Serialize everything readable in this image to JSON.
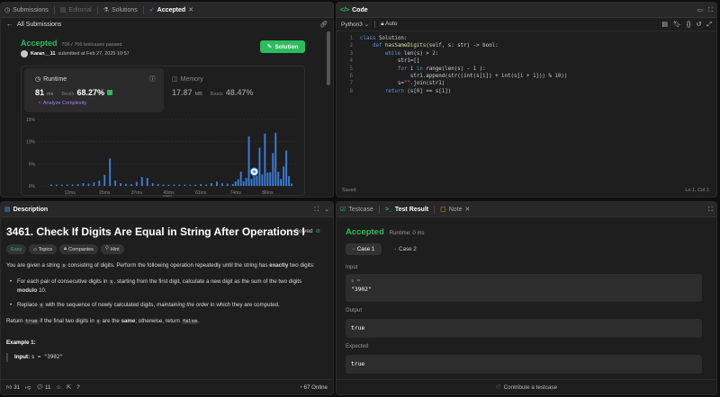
{
  "submissions_panel": {
    "tabs": [
      {
        "label": "Submissions",
        "icon": "clock-icon"
      },
      {
        "label": "Editorial",
        "icon": "book-icon"
      },
      {
        "label": "Solutions",
        "icon": "flask-icon"
      },
      {
        "label": "Accepted",
        "icon": "check-icon"
      }
    ],
    "back_label": "All Submissions",
    "status": "Accepted",
    "passed": "706 / 706 testcases passed",
    "user": "Karan__11",
    "submitted": "submitted at Feb 27, 2025 10:57",
    "solution_button": "Solution",
    "runtime": {
      "label": "Runtime",
      "value": "81",
      "unit": "ms",
      "beats_label": "Beats",
      "beats": "68.27%",
      "analyze": "Analyze Complexity"
    },
    "memory": {
      "label": "Memory",
      "value": "17.87",
      "unit": "MB",
      "beats_label": "Beats",
      "beats": "48.47%"
    }
  },
  "chart_data": {
    "type": "bar",
    "yticks": [
      "15%",
      "10%",
      "5%",
      "0%"
    ],
    "ylim": [
      0,
      15
    ],
    "xticks": [
      "12ms",
      "25ms",
      "37ms",
      "49ms",
      "61ms",
      "74ms",
      "86ms"
    ],
    "x": [
      5,
      7,
      9,
      11,
      13,
      15,
      17,
      19,
      21,
      23,
      25,
      27,
      29,
      31,
      33,
      35,
      37,
      39,
      41,
      43,
      45,
      47,
      49,
      51,
      53,
      55,
      57,
      59,
      61,
      63,
      65,
      67,
      69,
      71,
      73,
      74,
      75,
      76,
      77,
      78,
      79,
      80,
      81,
      82,
      83,
      84,
      85,
      86,
      87,
      88,
      89,
      90,
      91,
      92,
      93,
      94,
      95
    ],
    "values": [
      0.3,
      0.3,
      0.3,
      0.3,
      0.3,
      0.4,
      0.6,
      0.5,
      0.8,
      1.2,
      2.5,
      6.2,
      1.2,
      0.6,
      0.5,
      0.4,
      0.9,
      2.0,
      1.8,
      0.6,
      0.4,
      0.3,
      0.3,
      0.3,
      0.3,
      0.3,
      0.3,
      0.3,
      0.4,
      0.3,
      0.6,
      1.0,
      0.6,
      0.5,
      0.4,
      1.0,
      1.5,
      3.2,
      1.0,
      1.8,
      11.2,
      1.6,
      2.2,
      2.3,
      8.6,
      2.6,
      11.8,
      3.0,
      3.1,
      7.4,
      12.0,
      3.2,
      1.6,
      4.4,
      8.0,
      2.2,
      0.5
    ],
    "highlight_x": 81,
    "bar_color": "#3a7fd9"
  },
  "code_panel": {
    "title": "Code",
    "language": "Python3",
    "auto": "Auto",
    "lines": [
      [
        {
          "t": "class ",
          "c": "kw"
        },
        {
          "t": "Solution:",
          "c": "tx"
        }
      ],
      [
        {
          "t": "    def ",
          "c": "kw"
        },
        {
          "t": "hasSameDigits",
          "c": "fn"
        },
        {
          "t": "(self, s: str) -> bool:",
          "c": "tx"
        }
      ],
      [
        {
          "t": "        while ",
          "c": "kw"
        },
        {
          "t": "len(s) > ",
          "c": "tx"
        },
        {
          "t": "2",
          "c": "nm"
        },
        {
          "t": ":",
          "c": "tx"
        }
      ],
      [
        {
          "t": "            str1=[]",
          "c": "tx"
        }
      ],
      [
        {
          "t": "            for ",
          "c": "kw"
        },
        {
          "t": "i ",
          "c": "tx"
        },
        {
          "t": "in ",
          "c": "kw"
        },
        {
          "t": "range(len(s) - ",
          "c": "tx"
        },
        {
          "t": "1",
          "c": "nm"
        },
        {
          "t": " ):",
          "c": "tx"
        }
      ],
      [
        {
          "t": "                str1.append(str((int(s[i]) + int(s[i + ",
          "c": "tx"
        },
        {
          "t": "1",
          "c": "nm"
        },
        {
          "t": "])) % ",
          "c": "tx"
        },
        {
          "t": "10",
          "c": "nm"
        },
        {
          "t": "))",
          "c": "tx"
        }
      ],
      [
        {
          "t": "            s=",
          "c": "tx"
        },
        {
          "t": "\"\"",
          "c": "st"
        },
        {
          "t": ".join(str1)",
          "c": "tx"
        }
      ],
      [
        {
          "t": "        return ",
          "c": "kw"
        },
        {
          "t": "(s[",
          "c": "tx"
        },
        {
          "t": "0",
          "c": "nm"
        },
        {
          "t": "] == s[",
          "c": "tx"
        },
        {
          "t": "1",
          "c": "nm"
        },
        {
          "t": "])",
          "c": "tx"
        }
      ]
    ],
    "status": "Saved",
    "cursor": "Ln 1, Col 1"
  },
  "description_panel": {
    "tab": "Description",
    "title": "3461. Check If Digits Are Equal in String After Operations I",
    "solved": "Solved",
    "chips": [
      {
        "label": "Easy",
        "icon": ""
      },
      {
        "label": "Topics",
        "icon": "tag-icon"
      },
      {
        "label": "Companies",
        "icon": "lock-icon"
      },
      {
        "label": "Hint",
        "icon": "bulb-icon"
      }
    ],
    "p1_a": "You are given a string ",
    "p1_code": "s",
    "p1_b": " consisting of digits. Perform the following operation repeatedly until the string has ",
    "p1_bold": "exactly",
    "p1_c": " two digits:",
    "b1_a": "For each pair of consecutive digits in ",
    "b1_code": "s",
    "b1_b": ", starting from the first digit, calculate a new digit as the sum of the two digits ",
    "b1_bold": "modulo",
    "b1_c": " 10.",
    "b2_a": "Replace ",
    "b2_code": "s",
    "b2_b": " with the sequence of newly calculated digits, ",
    "b2_em": "maintaining the order",
    "b2_c": " in which they are computed.",
    "p2_a": "Return ",
    "p2_code1": "true",
    "p2_b": " if the final two digits in ",
    "p2_code2": "s",
    "p2_c": " are the ",
    "p2_bold": "same",
    "p2_d": "; otherwise, return ",
    "p2_code3": "false",
    "p2_e": ".",
    "example_title": "Example 1:",
    "example_input_label": "Input:",
    "example_input": "s = \"3902\"",
    "footer": {
      "likes": "31",
      "comments": "11",
      "online": "67 Online"
    }
  },
  "result_panel": {
    "tabs": [
      {
        "label": "Testcase",
        "icon": "checkbox-icon"
      },
      {
        "label": "Test Result",
        "icon": "terminal-icon"
      },
      {
        "label": "Note",
        "icon": "note-icon"
      }
    ],
    "status": "Accepted",
    "runtime": "Runtime: 0 ms",
    "cases": [
      "Case 1",
      "Case 2"
    ],
    "input_label": "Input",
    "input_var": "s =",
    "input_value": "\"3902\"",
    "output_label": "Output",
    "output_value": "true",
    "expected_label": "Expected",
    "expected_value": "true",
    "contribute": "Contribute a testcase"
  }
}
